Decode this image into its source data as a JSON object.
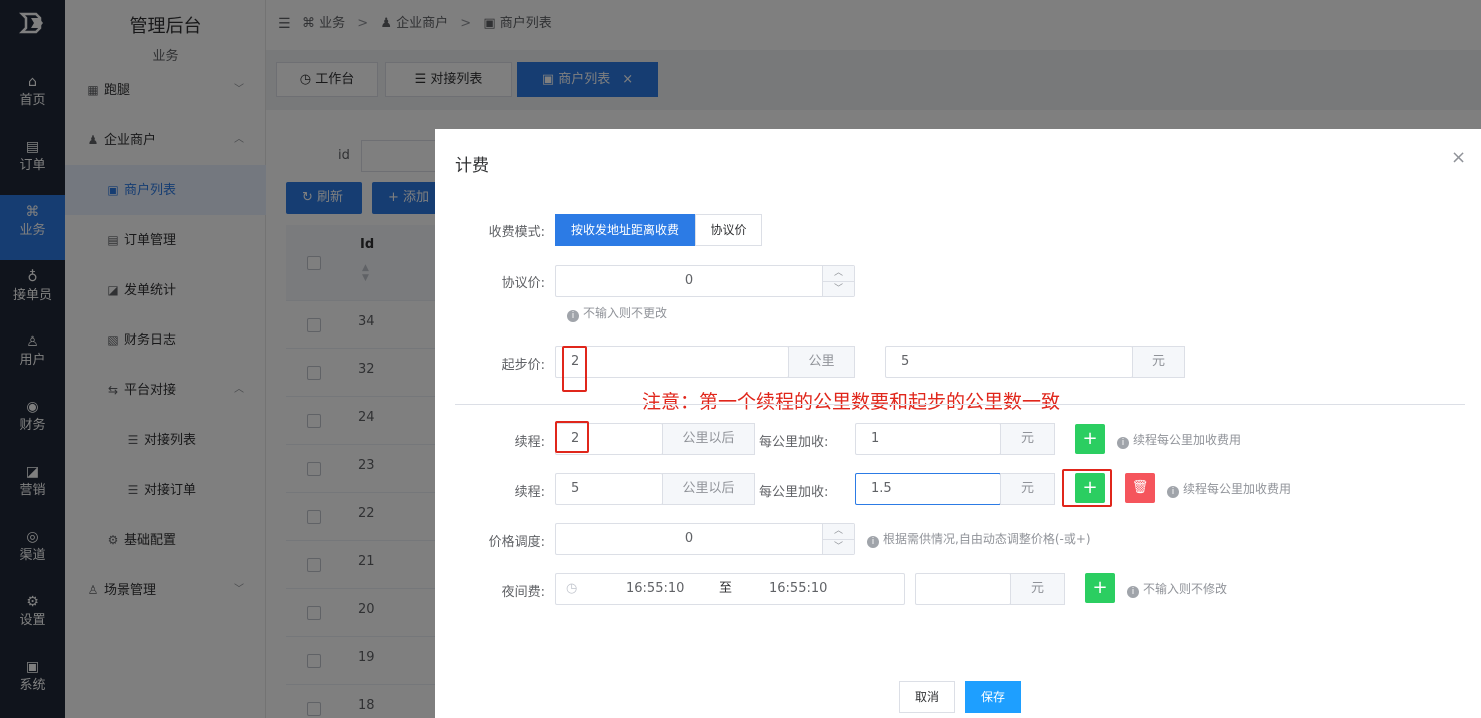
{
  "nav": {
    "items": [
      {
        "label": "首页",
        "icon": "home-icon"
      },
      {
        "label": "订单",
        "icon": "order-icon"
      },
      {
        "label": "业务",
        "icon": "apps-icon"
      },
      {
        "label": "接单员",
        "icon": "bike-icon"
      },
      {
        "label": "用户",
        "icon": "user-icon"
      },
      {
        "label": "财务",
        "icon": "finance-icon"
      },
      {
        "label": "营销",
        "icon": "chart-icon"
      },
      {
        "label": "渠道",
        "icon": "compass-icon"
      },
      {
        "label": "设置",
        "icon": "settings-icon"
      },
      {
        "label": "系统",
        "icon": "system-icon"
      }
    ],
    "active_index": 2
  },
  "sidebar": {
    "title": "管理后台",
    "subtitle": "业务",
    "menus": [
      {
        "label": "跑腿"
      },
      {
        "label": "企业商户"
      },
      {
        "label": "商户列表"
      },
      {
        "label": "订单管理"
      },
      {
        "label": "发单统计"
      },
      {
        "label": "财务日志"
      },
      {
        "label": "平台对接"
      },
      {
        "label": "对接列表"
      },
      {
        "label": "对接订单"
      },
      {
        "label": "基础配置"
      },
      {
        "label": "场景管理"
      }
    ]
  },
  "breadcrumb": {
    "level1": "业务",
    "level2": "企业商户",
    "level3": "商户列表"
  },
  "tabs": [
    {
      "label": "工作台"
    },
    {
      "label": "对接列表"
    },
    {
      "label": "商户列表"
    }
  ],
  "content": {
    "filter_label": "id",
    "refresh_label": "刷新",
    "add_label": "添加",
    "table_header": "Id",
    "rows": [
      "34",
      "32",
      "24",
      "23",
      "22",
      "21",
      "20",
      "19",
      "18"
    ]
  },
  "dialog": {
    "title": "计费",
    "mode_label": "收费模式:",
    "mode_options": [
      "按收发地址距离收费",
      "协议价"
    ],
    "agreement_label": "协议价:",
    "agreement_value": "0",
    "agreement_hint": "不输入则不更改",
    "start_label": "起步价:",
    "start_km": "2",
    "start_km_unit": "公里",
    "start_price": "5",
    "start_price_unit": "元",
    "note": "注意：第一个续程的公里数要和起步的公里数一致",
    "continue_rows": [
      {
        "label": "续程:",
        "km": "2",
        "km_unit": "公里以后",
        "per_label": "每公里加收:",
        "price": "1",
        "price_unit": "元",
        "hint": "续程每公里加收费用"
      },
      {
        "label": "续程:",
        "km": "5",
        "km_unit": "公里以后",
        "per_label": "每公里加收:",
        "price": "1.5",
        "price_unit": "元",
        "hint": "续程每公里加收费用"
      }
    ],
    "adjust_label": "价格调度:",
    "adjust_value": "0",
    "adjust_hint": "根据需供情况,自由动态调整价格(-或+)",
    "night_label": "夜间费:",
    "night_start": "16:55:10",
    "night_sep": "至",
    "night_end": "16:55:10",
    "night_unit": "元",
    "night_hint": "不输入则不修改",
    "cancel_label": "取消",
    "save_label": "保存"
  },
  "colors": {
    "primary": "#2c7be5",
    "success": "#2bce61",
    "danger": "#f5555c",
    "annotation": "#e0261b",
    "nav_bg": "#202938"
  }
}
